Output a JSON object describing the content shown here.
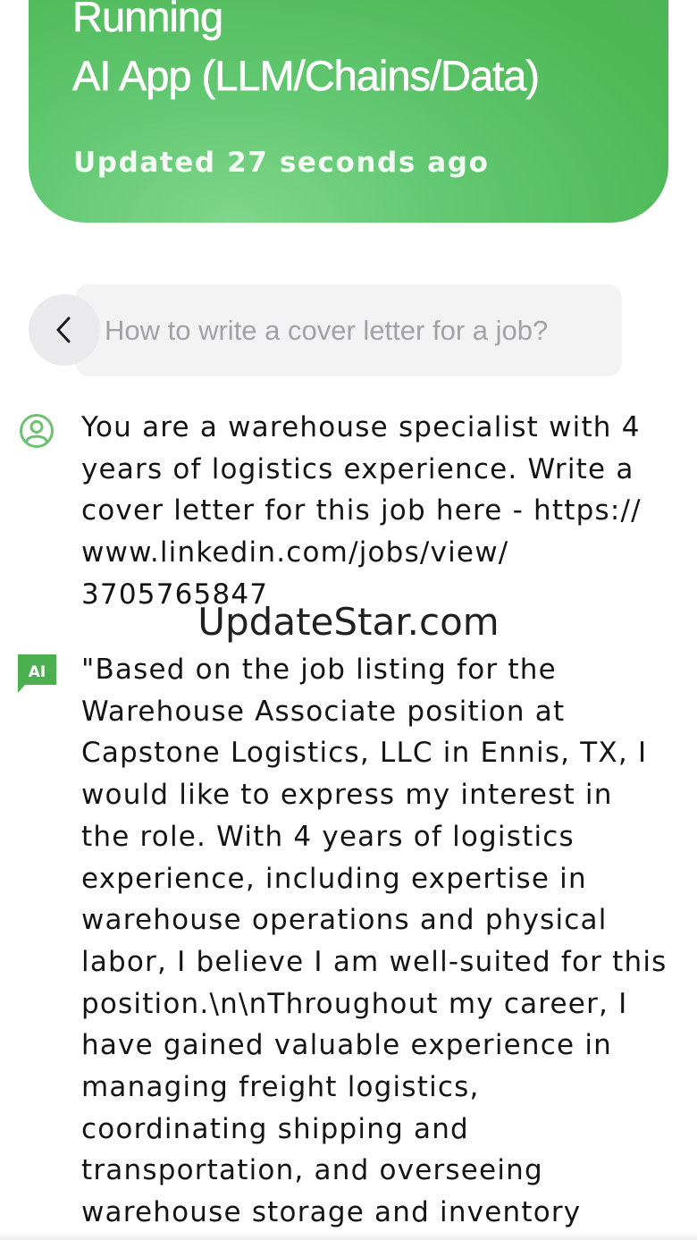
{
  "header": {
    "status": "Running",
    "app_name": "AI App (LLM/Chains/Data)",
    "updated": "Updated 27 seconds ago"
  },
  "prompt_bar": {
    "query": "How to write a cover letter for a job?",
    "back_icon": "chevron-left-icon"
  },
  "conversation": {
    "user_message": "You are a warehouse specialist with 4\nyears of logistics experience. Write a\ncover letter for this job here - https://\nwww.linkedin.com/jobs/view/\n3705765847",
    "ai_badge": "AI",
    "ai_message": "\"Based on the job listing for the\nWarehouse Associate position at\nCapstone Logistics, LLC in Ennis, TX, I\nwould like to express my interest in\nthe role. With 4 years of logistics\nexperience, including expertise in\nwarehouse operations and physical\nlabor, I believe I am well-suited for this\nposition.\\n\\nThroughout my career, I\nhave gained valuable experience in\nmanaging freight logistics,\ncoordinating shipping and\ntransportation, and overseeing\nwarehouse storage and inventory"
  },
  "watermark": "UpdateStar.com",
  "colors": {
    "status_green": "#55bd5e",
    "avatar_green": "#6cc070",
    "ai_badge_green": "#4caf50",
    "prompt_bg": "#f3f3f4"
  }
}
